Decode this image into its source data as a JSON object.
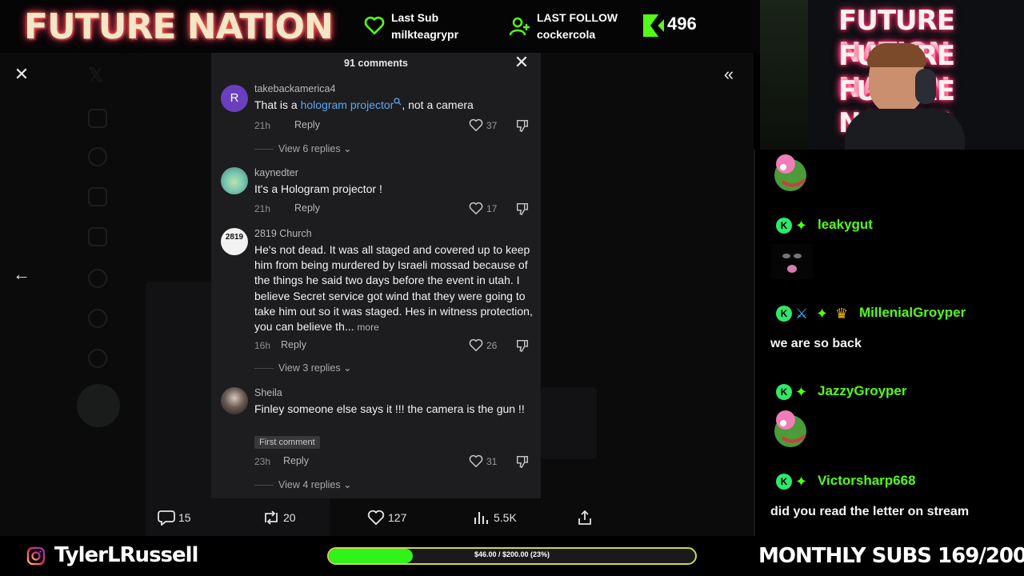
{
  "overlay": {
    "brand": "FUTURE NATION",
    "last_sub_label": "Last Sub",
    "last_sub_name": "milkteagrypr",
    "last_follow_label": "LAST FOLLOW",
    "last_follow_name": "cockercola",
    "kick_count": "496",
    "ig_handle": "TylerLRussell",
    "goal_text": "$46.00 / $200.00 (23%)",
    "goal_fraction": 0.23,
    "monthly_subs": "MONTHLY SUBS 169/200",
    "cam_neon_lines": [
      "FUTURE NATION",
      "FUTURE NATION",
      "FUTURE NATION"
    ],
    "accent_green": "#53fc18"
  },
  "comments_panel": {
    "header": "91 comments",
    "comments": [
      {
        "user": "takebackamerica4",
        "avatar_letter": "R",
        "text_before": "That is a ",
        "text_link": "hologram projector",
        "text_after": ", not a camera",
        "time": "21h",
        "reply": "Reply",
        "likes": "37",
        "view_replies": "View 6 replies"
      },
      {
        "user": "kaynedter",
        "text": "It's a Hologram projector !",
        "time": "21h",
        "reply": "Reply",
        "likes": "17"
      },
      {
        "user": "2819 Church",
        "avatar_text": "2819",
        "text": "He's not dead. It was all staged and covered up to keep him from being murdered by Israeli mossad because of the things he said two days before the event in utah. I believe Secret service got wind that they were going to take him out so it was staged. Hes in witness protection, you can believe th...",
        "more": "more",
        "time": "16h",
        "reply": "Reply",
        "likes": "26",
        "view_replies": "View 3 replies"
      },
      {
        "user": "Sheila",
        "text": "Finley someone else says it !!! the camera is the gun !!",
        "badge": "First comment",
        "time": "23h",
        "reply": "Reply",
        "likes": "31",
        "view_replies": "View 4 replies"
      }
    ]
  },
  "tweet_actions": {
    "replies": "15",
    "reposts": "20",
    "likes": "127",
    "views": "5.5K"
  },
  "chat": {
    "messages": [
      {
        "user": "leakygut",
        "badges": [
          "kick-icon",
          "gift-icon"
        ]
      },
      {
        "user": "MillenialGroyper",
        "badges": [
          "kick-icon",
          "sword-icon",
          "gift-icon",
          "crown-icon"
        ],
        "text": "we are so back"
      },
      {
        "user": "JazzyGroyper",
        "badges": [
          "kick-icon",
          "gift-icon"
        ]
      },
      {
        "user": "Victorsharp668",
        "badges": [
          "kick-icon",
          "gift-icon"
        ],
        "text": "did you read the letter on stream"
      }
    ]
  }
}
